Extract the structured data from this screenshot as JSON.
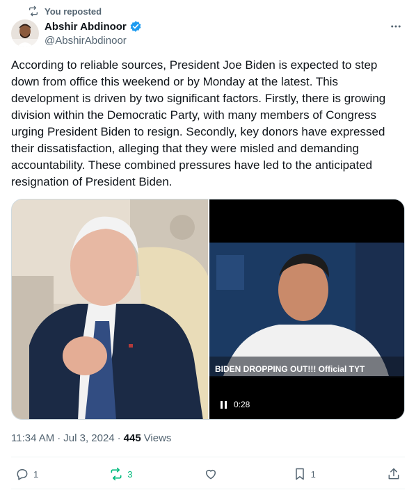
{
  "repost": {
    "label": "You reposted",
    "icon": "repost-icon"
  },
  "author": {
    "name": "Abshir Abdinoor",
    "handle": "@AbshirAbdinoor",
    "verified_icon": "verified-badge-icon",
    "verified_color": "#1d9bf0"
  },
  "tweet": {
    "text": "According to reliable sources, President Joe Biden is expected to step down from office this weekend or by Monday at the latest. This development is driven by two significant factors. Firstly, there is growing division within the Democratic Party, with many members of Congress urging President Biden to resign. Secondly, key donors have expressed their dissatisfaction, alleging that they were misled and demanding accountability. These combined pressures have led to the anticipated resignation of President Biden."
  },
  "media": {
    "video_caption": "BIDEN DROPPING OUT!!! Official TYT",
    "video_time": "0:28"
  },
  "meta": {
    "time": "11:34 AM",
    "separator": "·",
    "date": "Jul 3, 2024",
    "views_count": "445",
    "views_label": "Views"
  },
  "actions": {
    "replies": "1",
    "reposts": "3",
    "likes": "",
    "bookmarks": "1",
    "repost_color": "#00ba7c"
  }
}
